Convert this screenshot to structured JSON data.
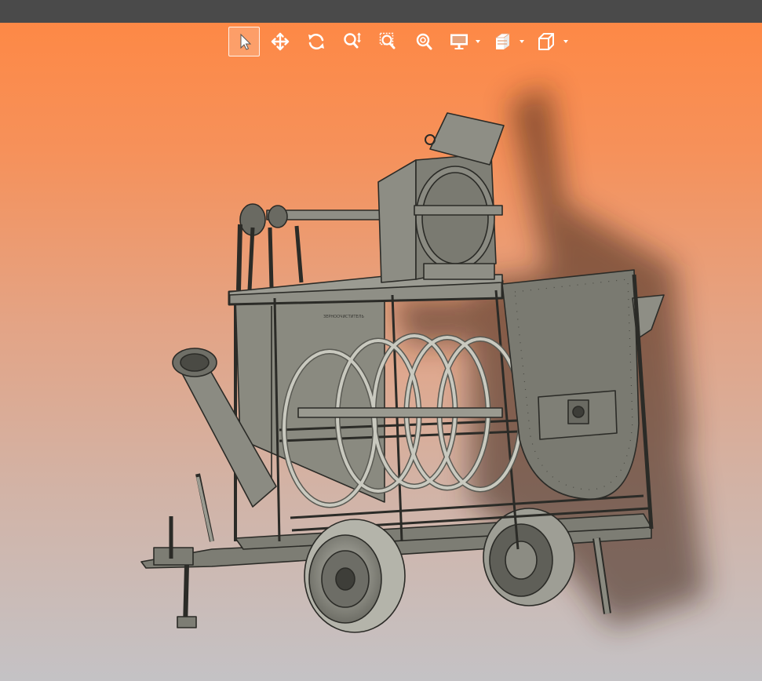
{
  "window": {
    "titlebar_color": "#4a4a4a"
  },
  "toolbar": {
    "tools": [
      {
        "id": "select",
        "icon": "cursor-icon",
        "active": true
      },
      {
        "id": "pan",
        "icon": "move-arrows-icon",
        "active": false
      },
      {
        "id": "rotate",
        "icon": "rotate-icon",
        "active": false
      },
      {
        "id": "zoom",
        "icon": "zoom-vertical-icon",
        "active": false
      },
      {
        "id": "zoom-window",
        "icon": "zoom-window-icon",
        "active": false
      },
      {
        "id": "zoom-fit",
        "icon": "zoom-fit-icon",
        "active": false
      },
      {
        "id": "display",
        "icon": "monitor-icon",
        "dropdown": true
      },
      {
        "id": "section",
        "icon": "section-cube-icon",
        "dropdown": true
      },
      {
        "id": "view",
        "icon": "view-cube-icon",
        "dropdown": true
      }
    ],
    "icon_color": "#ffffff"
  },
  "viewport": {
    "background_top": "#ff8742",
    "background_bottom": "#c4c2c5",
    "model_color": "#7d7d74",
    "model_edge_color": "#2b2b27",
    "model_plate_text": "ЗЕРНООЧИСТИТЕЛЬ"
  }
}
